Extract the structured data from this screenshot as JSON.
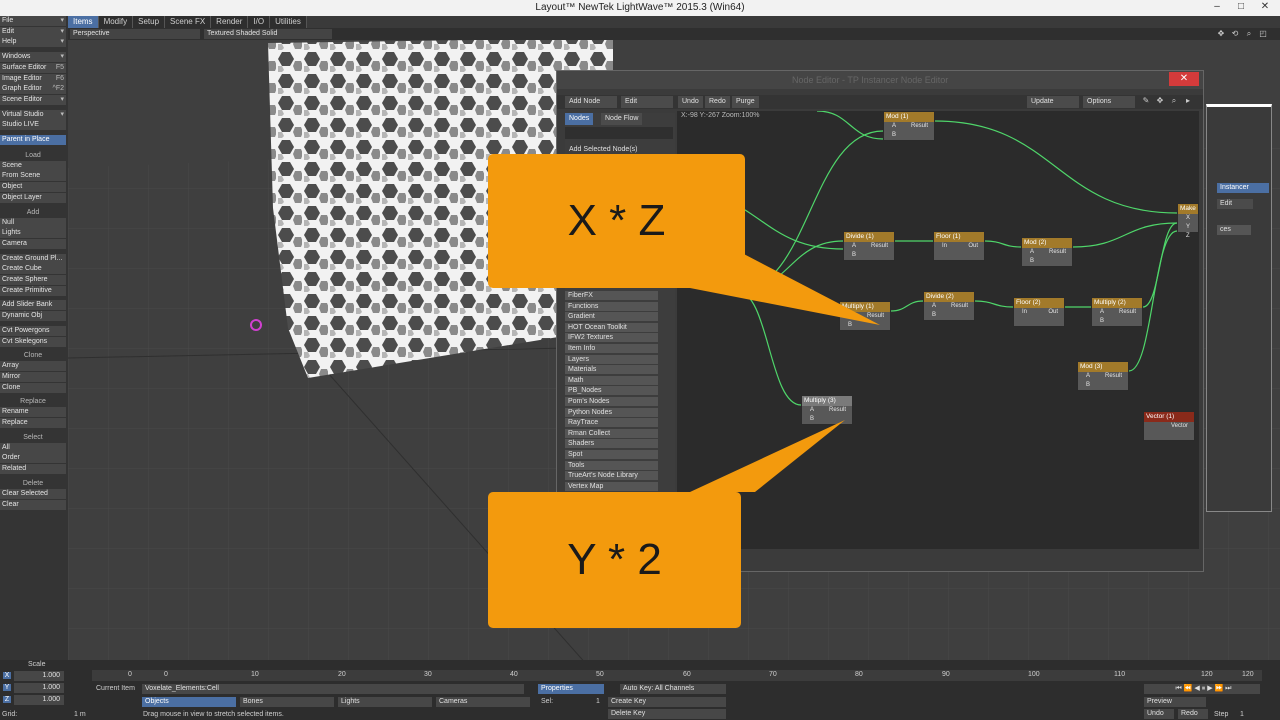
{
  "window": {
    "title": "Layout™ NewTek LightWave™ 2015.3 (Win64)",
    "min": "–",
    "max": "□",
    "close": "✕"
  },
  "tabs": [
    "Items",
    "Modify",
    "Setup",
    "Scene FX",
    "Render",
    "I/O",
    "Utilities"
  ],
  "left_panel": {
    "top_items": [
      {
        "label": "File",
        "caret": "▾"
      },
      {
        "label": "Edit",
        "caret": "▾"
      },
      {
        "label": "Help",
        "caret": "▾"
      },
      {
        "label": "Windows",
        "caret": "▾"
      },
      {
        "label": "Surface Editor",
        "caret": "F5"
      },
      {
        "label": "Image Editor",
        "caret": "F6"
      },
      {
        "label": "Graph Editor",
        "caret": "^F2"
      },
      {
        "label": "Scene Editor",
        "caret": "▾"
      },
      {
        "label": "Virtual Studio",
        "caret": "▾"
      },
      {
        "label": "Studio LIVE",
        "caret": ""
      },
      {
        "label": "Parent in Place",
        "caret": ""
      }
    ],
    "sections": [
      {
        "head": "Load",
        "items": [
          "Scene",
          "From Scene",
          "Object",
          "Object Layer"
        ]
      },
      {
        "head": "Add",
        "items": [
          "Null",
          "Lights",
          "Camera",
          "Create Ground Pl...",
          "Create Cube",
          "Create Sphere",
          "Create Primitive",
          "Add Slider Bank",
          "Dynamic Obj",
          "Cvt Powergons",
          "Cvt Skelegons"
        ]
      },
      {
        "head": "Clone",
        "items": [
          "Array",
          "Mirror",
          "Clone"
        ]
      },
      {
        "head": "Replace",
        "items": [
          "Rename",
          "Replace"
        ]
      },
      {
        "head": "Select",
        "items": [
          "All",
          "Order",
          "Related"
        ]
      },
      {
        "head": "Delete",
        "items": [
          "Clear Selected",
          "Clear"
        ]
      }
    ]
  },
  "viewport": {
    "view_mode": "Perspective",
    "shading_mode": "Textured Shaded Solid"
  },
  "node_editor": {
    "title": "Node Editor - TP Instancer Node Editor",
    "close": "✕",
    "toolbar": {
      "add_node": "Add Node",
      "edit": "Edit",
      "undo": "Undo",
      "redo": "Redo",
      "purge": "Purge",
      "update": "Update",
      "options": "Options"
    },
    "list_tabs": [
      "Nodes",
      "Node Flow"
    ],
    "add_selected": "Add Selected Node(s)",
    "categories": [
      "FiberFX",
      "Functions",
      "Gradient",
      "HOT Ocean Toolkit",
      "IFW2 Textures",
      "Item Info",
      "Layers",
      "Materials",
      "Math",
      "PB_Nodes",
      "Pom's Nodes",
      "Python Nodes",
      "RayTrace",
      "Rman Collect",
      "Shaders",
      "Spot",
      "Tools",
      "TrueArt's Node Library",
      "Vertex Map"
    ],
    "coords": "X:-98 Y:-267 Zoom:100%",
    "nodes": [
      {
        "id": "mod1",
        "title": "Mod (1)",
        "in": [
          "A",
          "B"
        ],
        "out": "Result"
      },
      {
        "id": "divide1",
        "title": "Divide (1)",
        "in": [
          "A",
          "B"
        ],
        "out": "Result"
      },
      {
        "id": "floor1",
        "title": "Floor (1)",
        "in": [
          "In"
        ],
        "out": "Out"
      },
      {
        "id": "mod2",
        "title": "Mod (2)",
        "in": [
          "A",
          "B"
        ],
        "out": "Result"
      },
      {
        "id": "multiply1",
        "title": "Multiply (1)",
        "in": [
          "A",
          "B"
        ],
        "out": "Result"
      },
      {
        "id": "divide2",
        "title": "Divide (2)",
        "in": [
          "A",
          "B"
        ],
        "out": "Result"
      },
      {
        "id": "floor2",
        "title": "Floor (2)",
        "in": [
          "In"
        ],
        "out": "Out"
      },
      {
        "id": "multiply2",
        "title": "Multiply (2)",
        "in": [
          "A",
          "B"
        ],
        "out": "Result"
      },
      {
        "id": "mod3",
        "title": "Mod (3)",
        "in": [
          "A",
          "B"
        ],
        "out": "Result"
      },
      {
        "id": "multiply3",
        "title": "Multiply (3)",
        "in": [
          "A",
          "B"
        ],
        "out": "Result"
      },
      {
        "id": "vector1",
        "title": "Vector (1)",
        "in": [],
        "out": "Vector"
      },
      {
        "id": "make",
        "title": "Make",
        "in": [
          "X",
          "Y",
          "Z"
        ],
        "out": ""
      }
    ]
  },
  "right_panel": {
    "tab": "Instancer",
    "edit": "Edit",
    "field": "ces"
  },
  "callouts": {
    "top": "X * Z",
    "bottom": "Y * 2"
  },
  "timeline": {
    "scale_label": "Scale",
    "xyz": [
      {
        "axis": "X",
        "value": "1.000"
      },
      {
        "axis": "Y",
        "value": "1.000"
      },
      {
        "axis": "Z",
        "value": "1.000"
      }
    ],
    "grid_label": "Grid:",
    "grid_value": "1 m",
    "ticks": [
      "0",
      "0",
      "10",
      "20",
      "30",
      "40",
      "50",
      "60",
      "70",
      "80",
      "90",
      "100",
      "110",
      "120",
      "120"
    ],
    "current_item_label": "Current Item",
    "current_item": "Voxelate_Elements:Cell",
    "properties": "Properties",
    "auto_key": "Auto Key: All Channels",
    "create_key": "Create Key",
    "delete_key": "Delete Key",
    "sel_label": "Sel:",
    "sel_value": "1",
    "objects": "Objects",
    "bones": "Bones",
    "lights": "Lights",
    "cameras": "Cameras",
    "status": "Drag mouse in view to stretch selected items.",
    "preview": "Preview",
    "step_label": "Step",
    "step_value": "1",
    "undo": "Undo",
    "redo": "Redo"
  }
}
